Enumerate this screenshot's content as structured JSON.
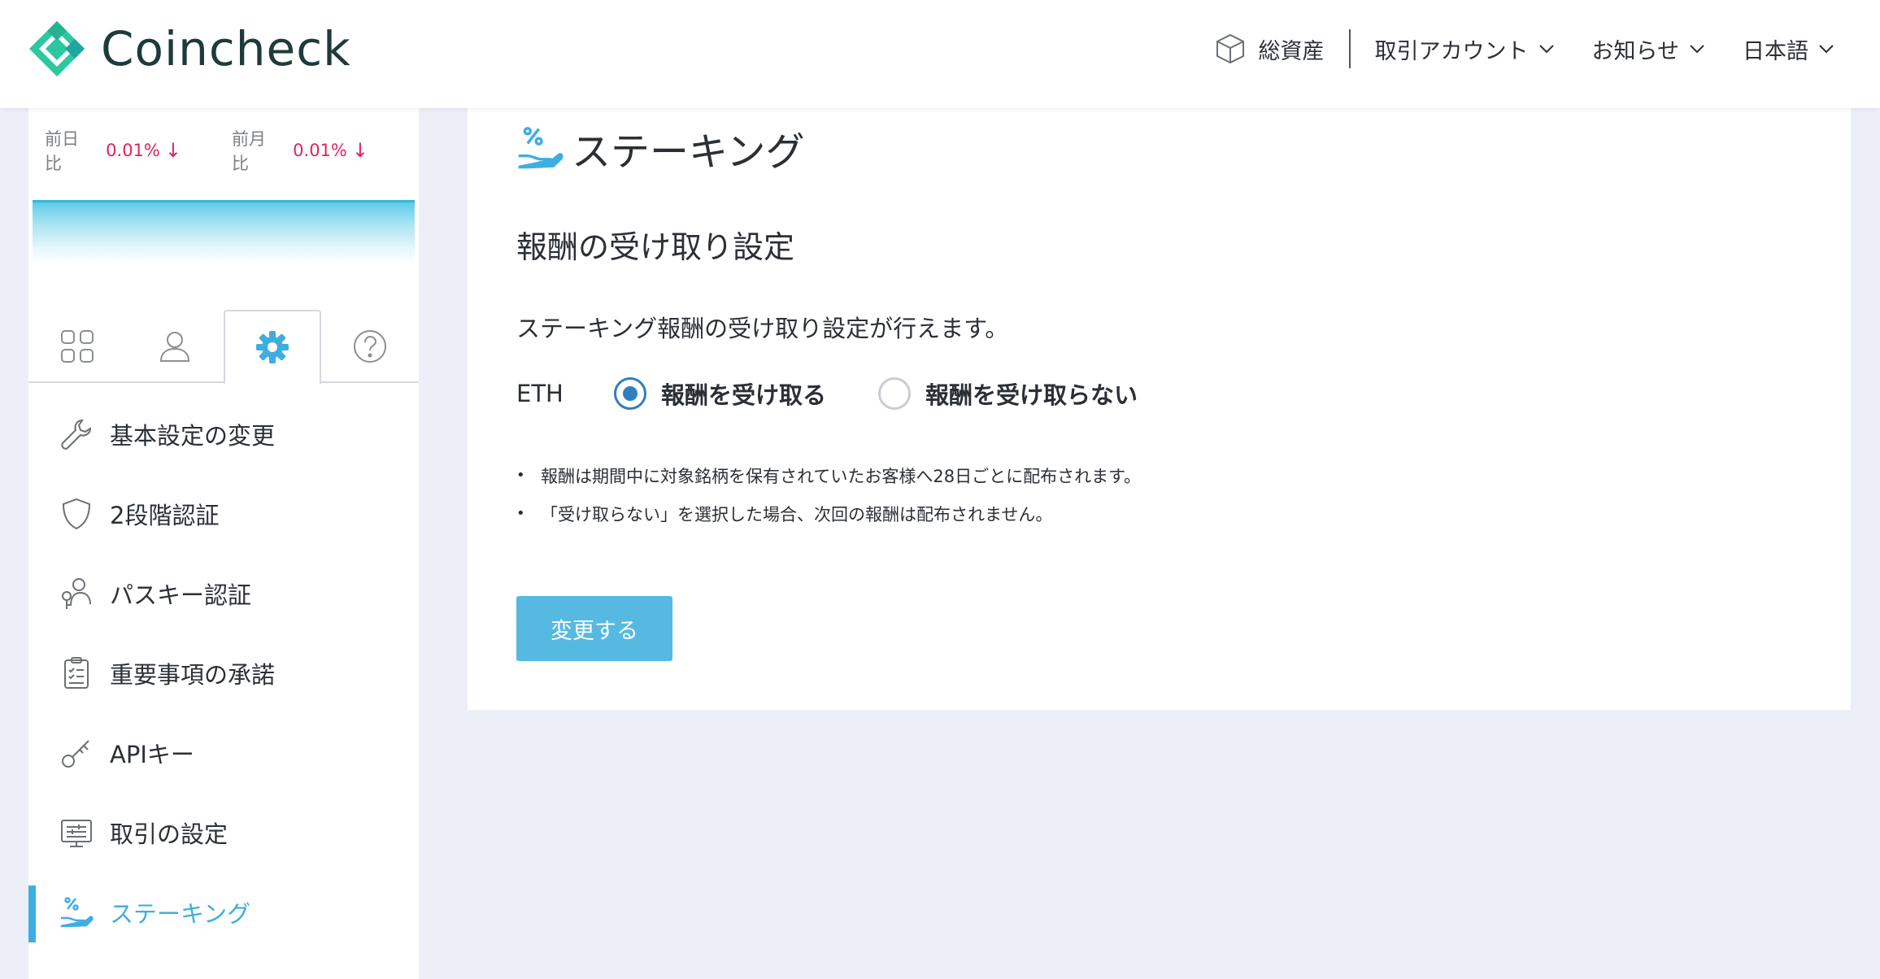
{
  "header": {
    "brand": "Coincheck",
    "nav": {
      "assets_label": "総資産",
      "account_label": "取引アカウント",
      "news_label": "お知らせ",
      "language_label": "日本語"
    }
  },
  "sidebar": {
    "rates": [
      {
        "label": "前日比",
        "value": "0.01%",
        "arrow": "↓"
      },
      {
        "label": "前月比",
        "value": "0.01%",
        "arrow": "↓"
      }
    ],
    "tabs": [
      {
        "icon": "grid-icon"
      },
      {
        "icon": "user-icon"
      },
      {
        "icon": "gear-icon",
        "active": true
      },
      {
        "icon": "help-icon"
      }
    ],
    "menu": [
      {
        "label": "基本設定の変更",
        "icon": "wrench-icon"
      },
      {
        "label": "2段階認証",
        "icon": "shield-icon"
      },
      {
        "label": "パスキー認証",
        "icon": "passkey-icon"
      },
      {
        "label": "重要事項の承諾",
        "icon": "clipboard-icon"
      },
      {
        "label": "APIキー",
        "icon": "key-icon"
      },
      {
        "label": "取引の設定",
        "icon": "settings-panel-icon"
      },
      {
        "label": "ステーキング",
        "icon": "staking-icon",
        "active": true
      }
    ]
  },
  "main": {
    "page_title": "ステーキング",
    "section_title": "報酬の受け取り設定",
    "description": "ステーキング報酬の受け取り設定が行えます。",
    "coin": "ETH",
    "options": [
      {
        "label": "報酬を受け取る",
        "checked": true
      },
      {
        "label": "報酬を受け取らない",
        "checked": false
      }
    ],
    "notes": [
      "報酬は期間中に対象銘柄を保有されていたお客様へ28日ごとに配布されます。",
      "「受け取らない」を選択した場合、次回の報酬は配布されません。"
    ],
    "submit_label": "変更する"
  },
  "colors": {
    "accent": "#3eaee0",
    "button": "#56b9e2",
    "negative": "#e0245e",
    "radio": "#2f7fc1",
    "brand": "#2bc8a1"
  }
}
